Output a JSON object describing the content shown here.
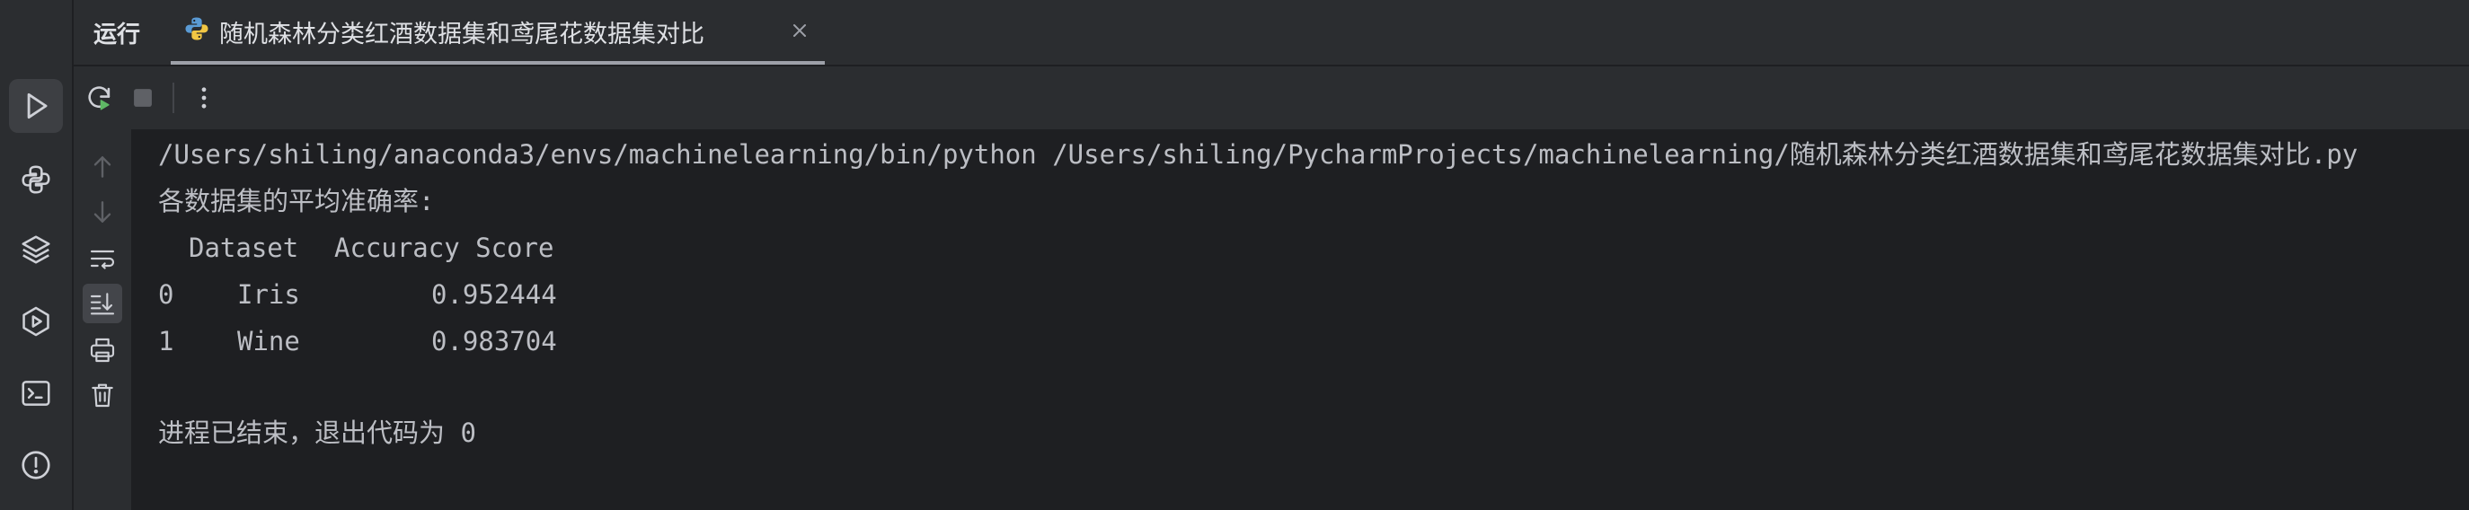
{
  "header": {
    "run_title": "运行",
    "tab_label": "随机森林分类红酒数据集和鸢尾花数据集对比"
  },
  "icons": {
    "strip": [
      "run-icon",
      "python-packages-icon",
      "layers-icon",
      "services-icon",
      "terminal-icon",
      "problems-icon"
    ],
    "toolbar": [
      "rerun-icon",
      "stop-icon",
      "more-icon"
    ],
    "side": [
      "scroll-up-icon",
      "scroll-down-icon",
      "soft-wrap-icon",
      "scroll-to-end-icon",
      "print-icon",
      "clear-icon"
    ]
  },
  "console": {
    "command": "/Users/shiling/anaconda3/envs/machinelearning/bin/python /Users/shiling/PycharmProjects/machinelearning/随机森林分类红酒数据集和鸢尾花数据集对比.py",
    "heading": "各数据集的平均准确率:",
    "table": {
      "columns": [
        "Dataset",
        "Accuracy Score"
      ],
      "rows": [
        {
          "index": "0",
          "dataset": "Iris",
          "score": "0.952444"
        },
        {
          "index": "1",
          "dataset": "Wine",
          "score": "0.983704"
        }
      ]
    },
    "exit_message": "进程已结束，退出代码为 0"
  },
  "colors": {
    "background": "#1e1f22",
    "panel": "#2b2d30",
    "text": "#bcbec4",
    "icon": "#ced0d6"
  }
}
